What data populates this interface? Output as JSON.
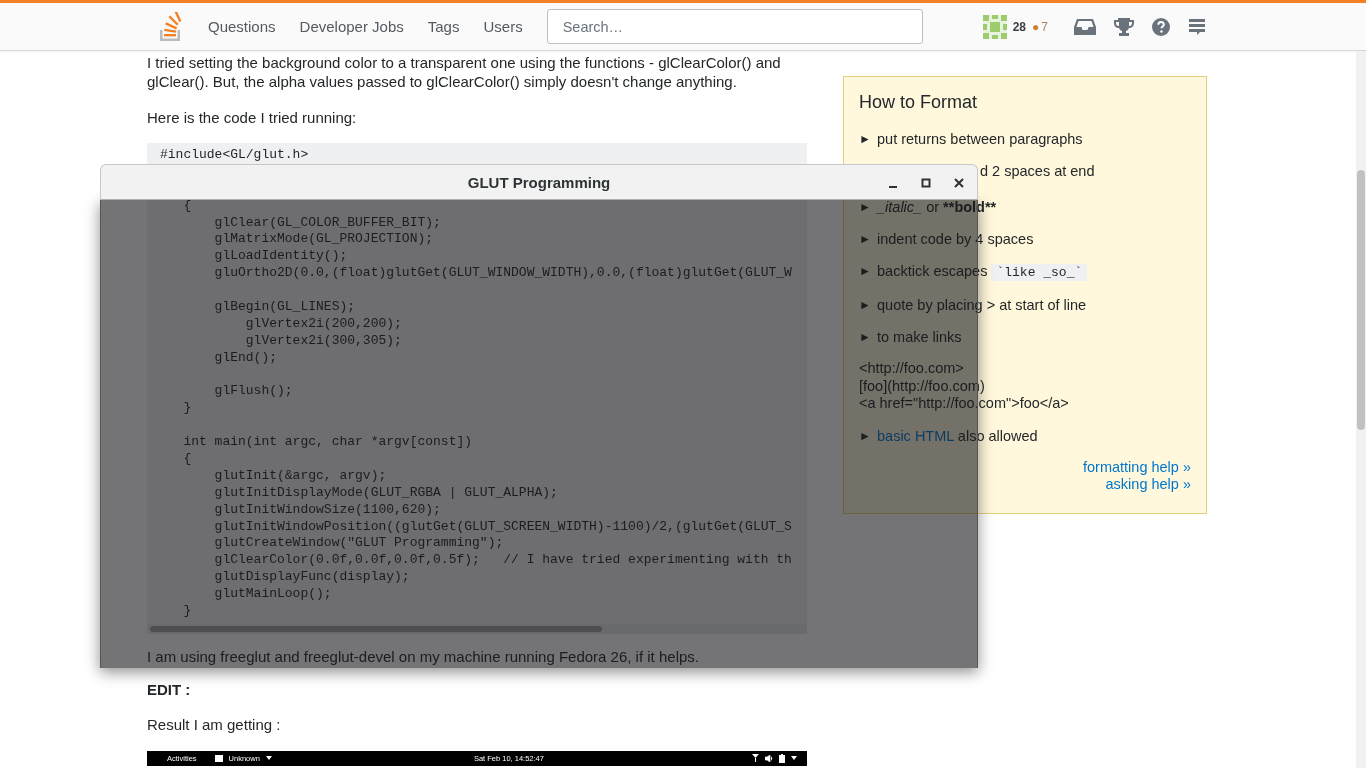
{
  "header": {
    "nav": [
      "Questions",
      "Developer Jobs",
      "Tags",
      "Users"
    ],
    "search": {
      "placeholder": "Search…"
    },
    "reputation": "28",
    "bronze_marker": "●",
    "bronze_count": "7"
  },
  "post": {
    "paragraphs": [
      "I tried setting the background color to a transparent one using the functions - glClearColor() and glClear(). But, the alpha values passed to glClearColor() simply doesn't change anything.",
      "Here is the code I tried running:"
    ],
    "code": "#include<GL/glut.h>\n\n\n   {\n       glClear(GL_COLOR_BUFFER_BIT);\n       glMatrixMode(GL_PROJECTION);\n       glLoadIdentity();\n       gluOrtho2D(0.0,(float)glutGet(GLUT_WINDOW_WIDTH),0.0,(float)glutGet(GLUT_W\n\n       glBegin(GL_LINES);\n           glVertex2i(200,200);\n           glVertex2i(300,305);\n       glEnd();\n\n       glFlush();\n   }\n\n   int main(int argc, char *argv[const])\n   {\n       glutInit(&argc, argv);\n       glutInitDisplayMode(GLUT_RGBA | GLUT_ALPHA);\n       glutInitWindowSize(1100,620);\n       glutInitWindowPosition((glutGet(GLUT_SCREEN_WIDTH)-1100)/2,(glutGet(GLUT_S\n       glutCreateWindow(\"GLUT Programming\");\n       glClearColor(0.0f,0.0f,0.0f,0.5f);   // I have tried experimenting with th\n       glutDisplayFunc(display);\n       glutMainLoop();\n   }",
    "after": [
      "I am using freeglut and freeglut-devel on my machine running Fedora 26, if it helps."
    ],
    "edit_label": "EDIT :",
    "result_label": "Result I am getting :",
    "screenshot": {
      "activities": "Activities",
      "app": "Unknown",
      "clock": "Sat Feb 10, 14:52:47"
    }
  },
  "sidebar": {
    "title": "How to Format",
    "items": [
      {
        "kind": "bullet",
        "marker": "►",
        "parts": [
          {
            "text": "put returns between paragraphs"
          }
        ]
      },
      {
        "kind": "clipped",
        "parts": [
          {
            "text": "d 2 spaces at end"
          }
        ]
      },
      {
        "kind": "bullet",
        "marker": "►",
        "parts": [
          {
            "text": "_italic_",
            "kind": "italic"
          },
          {
            "text": " or "
          },
          {
            "text": "**bold**",
            "kind": "bold"
          }
        ]
      },
      {
        "kind": "bullet",
        "marker": "►",
        "parts": [
          {
            "text": "indent code by 4 spaces"
          }
        ]
      },
      {
        "kind": "bullet",
        "marker": "►",
        "parts": [
          {
            "text": "backtick escapes "
          },
          {
            "text": "`like _so_`",
            "kind": "code"
          }
        ]
      },
      {
        "kind": "bullet",
        "marker": "►",
        "parts": [
          {
            "text": "quote by placing > at start of line"
          }
        ]
      },
      {
        "kind": "bullet",
        "marker": "►",
        "parts": [
          {
            "text": "to make links"
          }
        ]
      },
      {
        "kind": "example",
        "lines": [
          "<http://foo.com>",
          "[foo](http://foo.com)",
          "<a href=\"http://foo.com\">foo</a>"
        ]
      },
      {
        "kind": "bullet",
        "marker": "►",
        "parts": [
          {
            "text": "basic HTML",
            "kind": "link"
          },
          {
            "text": " also allowed"
          }
        ]
      }
    ],
    "links": [
      "formatting help »",
      "asking help »"
    ]
  },
  "window": {
    "title": "GLUT Programming"
  }
}
